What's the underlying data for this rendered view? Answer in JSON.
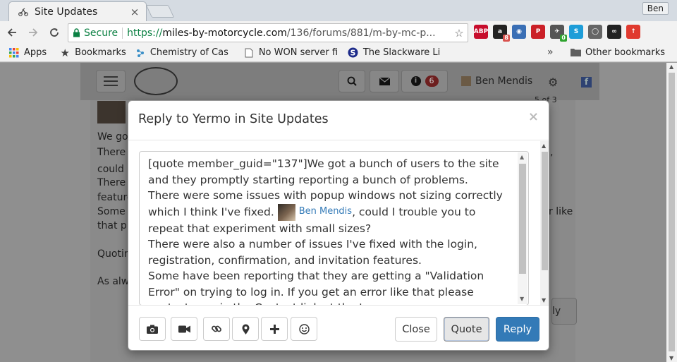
{
  "browser": {
    "tab_title": "Site Updates",
    "tab_close": "×",
    "profile": "Ben",
    "secure_label": "Secure",
    "url_scheme": "https://",
    "url_host": "miles-by-motorcycle.com",
    "url_path": "/136/forums/881/m-by-mc-p...",
    "extensions": [
      {
        "name": "adblock-plus-icon",
        "label": "ABP",
        "color": "#c70d2c"
      },
      {
        "name": "amazon-icon",
        "label": "a",
        "color": "#222222",
        "badge": "8",
        "badge_color": "#d9534f"
      },
      {
        "name": "globe-icon",
        "label": "◉",
        "color": "#3a6fb5"
      },
      {
        "name": "pinterest-icon",
        "label": "P",
        "color": "#cb2027"
      },
      {
        "name": "bird-icon",
        "label": "✈",
        "color": "#555555",
        "badge": "0",
        "badge_color": "#2ea32e"
      },
      {
        "name": "skype-icon",
        "label": "S",
        "color": "#1e9dd8"
      },
      {
        "name": "lightbulb-icon",
        "label": "◯",
        "color": "#666666"
      },
      {
        "name": "glasses-icon",
        "label": "∞",
        "color": "#222222"
      },
      {
        "name": "upload-icon",
        "label": "↑",
        "color": "#e03a2f"
      }
    ]
  },
  "bookmarks": {
    "apps": "Apps",
    "bookmarks": "Bookmarks",
    "chemistry": "Chemistry of Cas",
    "nowon": "No WON server fi",
    "slackware": "The Slackware Li",
    "chevron": "»",
    "other": "Other bookmarks"
  },
  "site": {
    "notif_count": "6",
    "user_name": "Ben Mendis"
  },
  "background": {
    "page_count": "5 of 3",
    "lines": [
      "We got",
      "There",
      "could I",
      "There",
      "feature",
      "Some",
      "that ple",
      "Quoting",
      "As alw"
    ],
    "right_text": "r like",
    "right_comma": ",",
    "btn_text": "ly"
  },
  "modal": {
    "title": "Reply to Yermo in Site Updates",
    "close": "×",
    "body": {
      "p1": "[quote member_guid=\"137\"]We got a bunch of users to the site and they promptly starting reporting a bunch of problems.",
      "p2_before": "There were some issues with popup windows not sizing correctly which I think I've fixed.",
      "mention": "Ben Mendis",
      "p2_after": ", could I trouble you to repeat that experiment with small sizes?",
      "p3": "There were also a number of issues I've fixed with the login, registration, confirmation, and invitation features.",
      "p4": "Some have been reporting that they are getting a \"Validation Error\" on trying to log in. If you get an error like that please contact me via the Contact link at the top."
    },
    "buttons": {
      "close": "Close",
      "quote": "Quote",
      "reply": "Reply"
    }
  }
}
